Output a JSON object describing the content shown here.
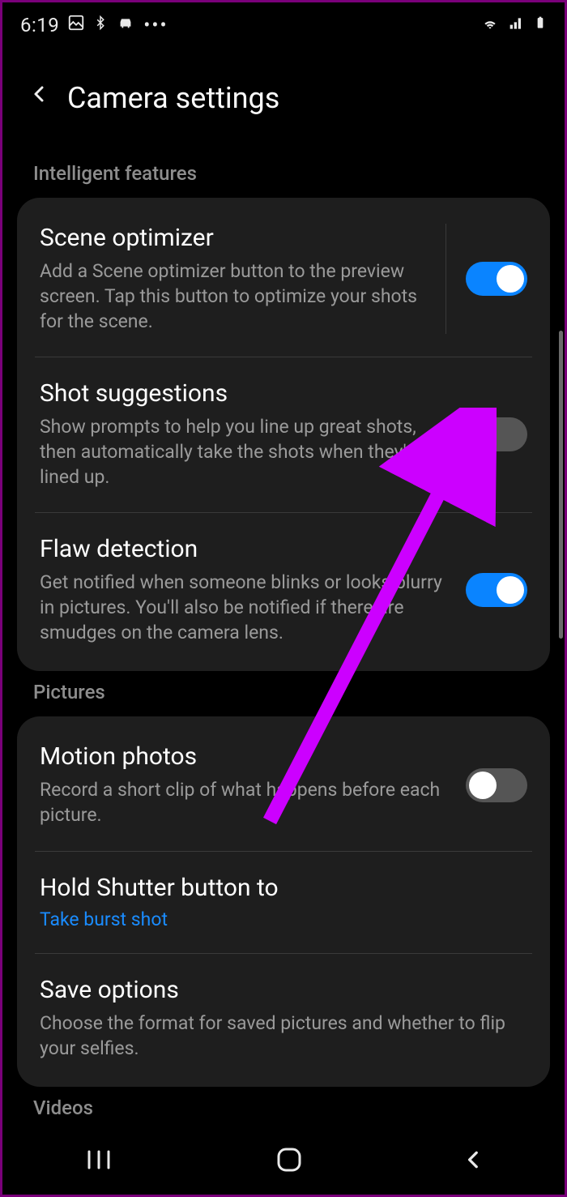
{
  "status": {
    "time": "6:19",
    "left_icons": [
      "gallery-icon",
      "bluetooth-icon",
      "car-icon",
      "more-icon"
    ],
    "right_icons": [
      "wifi-icon",
      "signal-icon",
      "battery-icon"
    ]
  },
  "header": {
    "title": "Camera settings"
  },
  "sections": {
    "intelligent": {
      "label": "Intelligent features",
      "scene_optimizer": {
        "title": "Scene optimizer",
        "desc": "Add a Scene optimizer button to the preview screen. Tap this button to optimize your shots for the scene.",
        "on": true
      },
      "shot_suggestions": {
        "title": "Shot suggestions",
        "desc": "Show prompts to help you line up great shots, then automatically take the shots when they're lined up.",
        "on": false
      },
      "flaw_detection": {
        "title": "Flaw detection",
        "desc": "Get notified when someone blinks or looks blurry in pictures. You'll also be notified if there are smudges on the camera lens.",
        "on": true
      }
    },
    "pictures": {
      "label": "Pictures",
      "motion_photos": {
        "title": "Motion photos",
        "desc": "Record a short clip of what happens before each picture.",
        "on": false
      },
      "hold_shutter": {
        "title": "Hold Shutter button to",
        "value": "Take burst shot"
      },
      "save_options": {
        "title": "Save options",
        "desc": "Choose the format for saved pictures and whether to flip your selfies."
      }
    },
    "videos": {
      "label": "Videos"
    }
  }
}
